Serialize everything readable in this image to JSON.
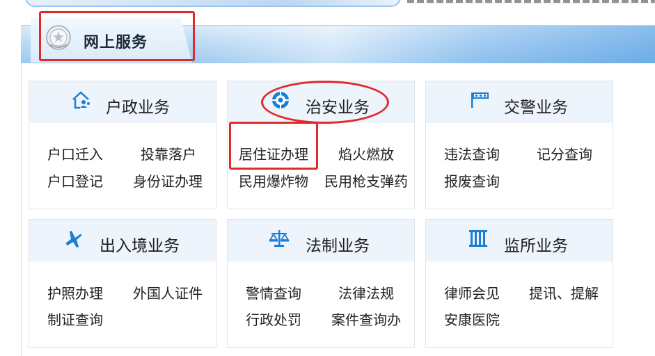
{
  "header": {
    "title": "网上服务"
  },
  "panels": [
    {
      "title": "户政业务",
      "icon": "house-people-icon",
      "items": [
        "户口迁入",
        "投靠落户",
        "户口登记",
        "身份证办理"
      ]
    },
    {
      "title": "治安业务",
      "icon": "shield-badge-icon",
      "items": [
        "居住证办理",
        "焰火燃放",
        "民用爆炸物",
        "民用枪支弹药"
      ]
    },
    {
      "title": "交警业务",
      "icon": "traffic-flag-icon",
      "items": [
        "违法查询",
        "记分查询",
        "报废查询"
      ]
    },
    {
      "title": "出入境业务",
      "icon": "airplane-icon",
      "items": [
        "护照办理",
        "外国人证件",
        "制证查询"
      ]
    },
    {
      "title": "法制业务",
      "icon": "scales-icon",
      "items": [
        "警情查询",
        "法律法规",
        "行政处罚",
        "案件查询办"
      ]
    },
    {
      "title": "监所业务",
      "icon": "prison-bars-icon",
      "items": [
        "律师会见",
        "提讯、提解",
        "安康医院"
      ]
    }
  ],
  "colors": {
    "accent_blue": "#1a7fd4",
    "annotation_red": "#e02a2a",
    "panel_header": "#eef4fb"
  }
}
